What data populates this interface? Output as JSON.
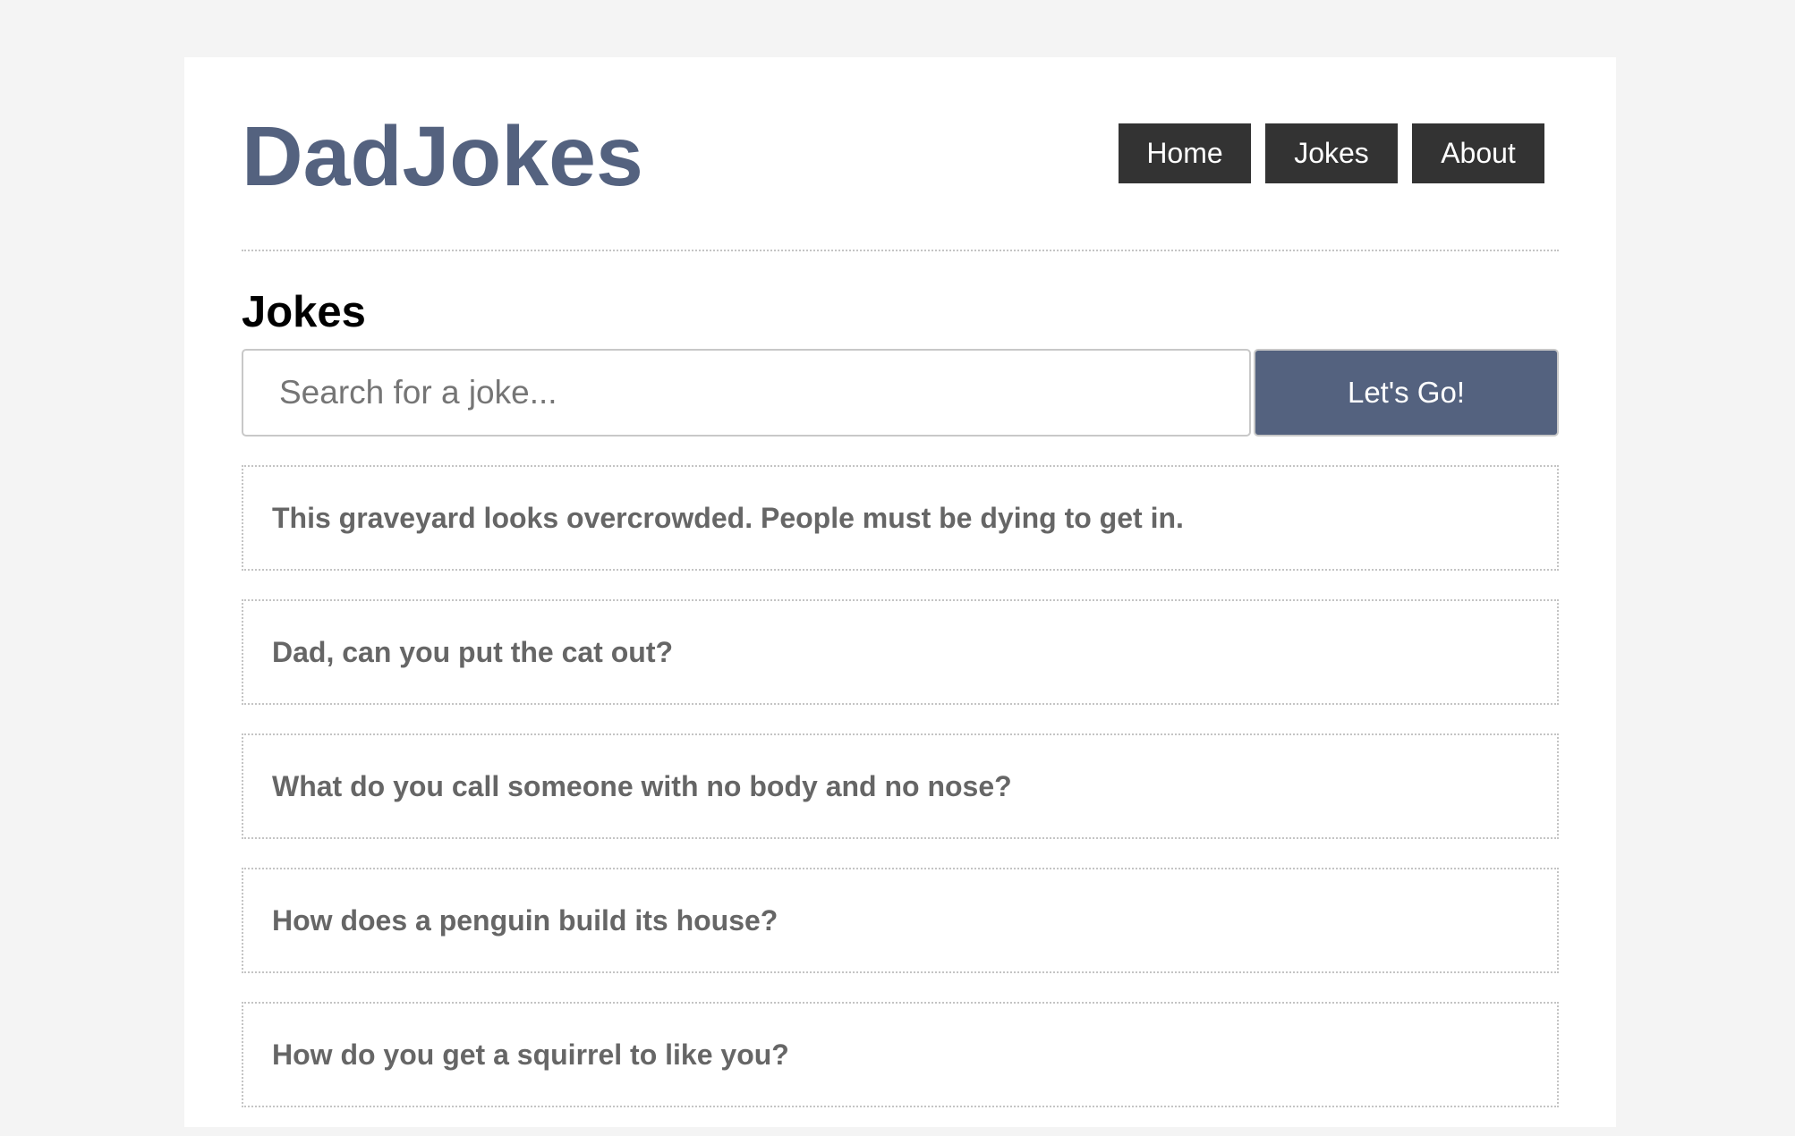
{
  "site": {
    "logo_text": "DadJokes"
  },
  "nav": {
    "items": [
      {
        "label": "Home"
      },
      {
        "label": "Jokes"
      },
      {
        "label": "About"
      }
    ]
  },
  "main": {
    "section_title": "Jokes",
    "search": {
      "placeholder": "Search for a joke...",
      "value": "",
      "button_label": "Let's Go!"
    },
    "jokes": [
      {
        "text": "This graveyard looks overcrowded. People must be dying to get in."
      },
      {
        "text": "Dad, can you put the cat out?"
      },
      {
        "text": "What do you call someone with no body and no nose?"
      },
      {
        "text": "How does a penguin build its house?"
      },
      {
        "text": "How do you get a squirrel to like you?"
      }
    ]
  },
  "colors": {
    "page_background": "#f4f4f4",
    "content_background": "#ffffff",
    "brand": "#54627f",
    "nav_background": "#333333",
    "joke_text": "#666666",
    "dotted_border": "#c4c4c4"
  }
}
